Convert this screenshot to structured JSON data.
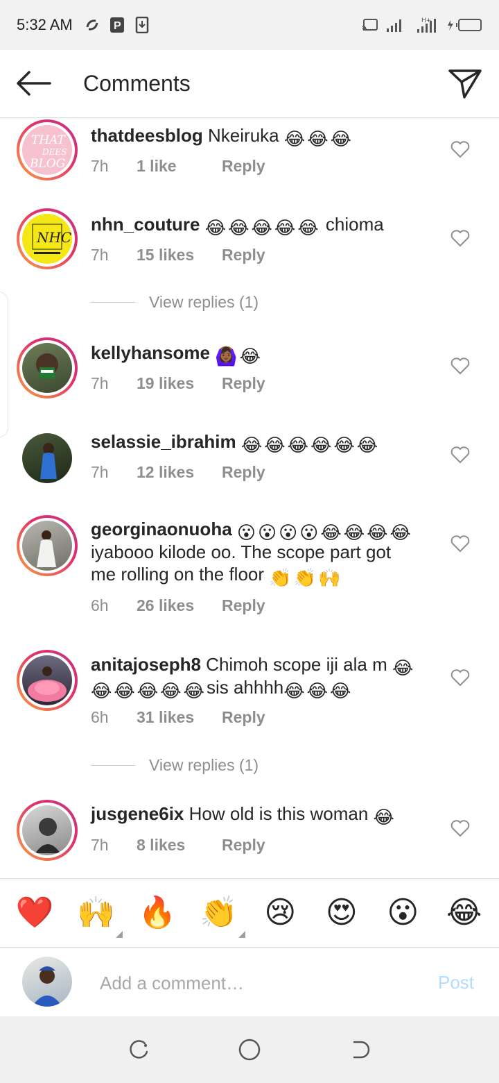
{
  "status_bar": {
    "time": "5:32 AM",
    "battery_indicator": "low-battery"
  },
  "header": {
    "title": "Comments"
  },
  "comments": [
    {
      "username": "thatdeesblog",
      "text": "Nkeiruka",
      "emojis_after": [
        "😂",
        "😂",
        "😂"
      ],
      "time": "7h",
      "likes": "1 like",
      "reply": "Reply",
      "avatar": "that-dees-blog-logo"
    },
    {
      "username": "nhn_couture",
      "emojis_before": [
        "😂",
        "😂",
        "😂",
        "😂",
        "😂"
      ],
      "text": "chioma",
      "time": "7h",
      "likes": "15 likes",
      "reply": "Reply",
      "view_replies": "View replies (1)",
      "avatar": "nhn-couture-logo"
    },
    {
      "username": "kellyhansome",
      "emojis_after": [
        "🙆🏾‍♀️",
        "😂"
      ],
      "time": "7h",
      "likes": "19 likes",
      "reply": "Reply",
      "avatar": "profile-photo"
    },
    {
      "username": "selassie_ibrahim",
      "emojis_after": [
        "😂",
        "😂",
        "😂",
        "😂",
        "😂",
        "😂"
      ],
      "time": "7h",
      "likes": "12 likes",
      "reply": "Reply",
      "avatar": "profile-photo"
    },
    {
      "username": "georginaonuoha",
      "emojis_line": [
        "😮",
        "😮",
        "😮",
        "😮",
        "😂",
        "😂",
        "😂",
        "😂"
      ],
      "text_line2": "iyabooo kilode oo. The scope part got",
      "text_line3": "me rolling on the floor",
      "emojis_end": [
        "👏",
        "👏",
        "🙌"
      ],
      "time": "6h",
      "likes": "26 likes",
      "reply": "Reply",
      "avatar": "profile-photo"
    },
    {
      "username": "anitajoseph8",
      "text": "Chimoh scope iji ala m",
      "text2": "sis ahhhh",
      "emojis_a": [
        "😂"
      ],
      "emojis_b": [
        "😂",
        "😂",
        "😂",
        "😂",
        "😂"
      ],
      "emojis_c": [
        "😂",
        "😂",
        "😂"
      ],
      "time": "6h",
      "likes": "31 likes",
      "reply": "Reply",
      "view_replies": "View replies (1)",
      "avatar": "profile-photo"
    },
    {
      "username": "jusgene6ix",
      "text": "How old is this woman",
      "emojis_after": [
        "😂"
      ],
      "time": "7h",
      "likes": "8 likes",
      "reply": "Reply",
      "avatar": "profile-photo"
    }
  ],
  "emoji_bar": [
    "❤️",
    "🙌",
    "🔥",
    "👏",
    "😢",
    "😍",
    "😮",
    "😂"
  ],
  "composer": {
    "placeholder": "Add a comment…",
    "post_label": "Post"
  },
  "nav": [
    "recent-apps-icon",
    "home-icon",
    "back-icon"
  ],
  "colors": {
    "accent": "#3897f0",
    "post_disabled": "#b3dbff",
    "meta": "#8e8e8e"
  }
}
